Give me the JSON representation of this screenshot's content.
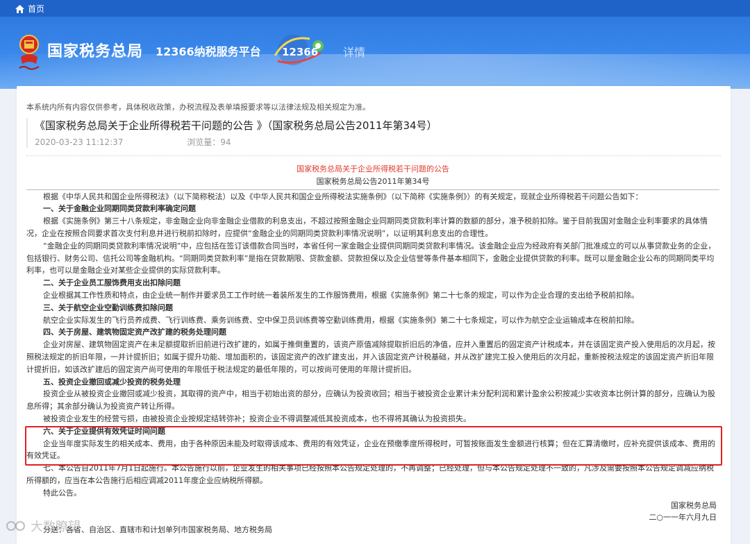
{
  "topbar": {
    "home_label": "首页"
  },
  "header": {
    "bureau_name": "国家税务总局",
    "platform_name": "12366纳税服务平台",
    "logo_text": "12366",
    "details_label": "详情"
  },
  "disclaimer": "本系统内所有内容仅供参考，具体税收政策，办税流程及表单填报要求等以法律法规及相关规定为准。",
  "article": {
    "title": "《国家税务总局关于企业所得税若干问题的公告 》（国家税务总局公告2011年第34号）",
    "date": "2020-03-23 11:12:37",
    "views": "浏览量：94"
  },
  "document": {
    "heading": "国家税务总局关于企业所得税若干问题的公告",
    "subheading": "国家税务总局公告2011年第34号",
    "intro": "根据《中华人民共和国企业所得税法》（以下简称税法）以及《中华人民共和国企业所得税法实施条例》（以下简称《实施条例》）的有关规定，现就企业所得税若干问题公告如下：",
    "s1_title": "一、关于金融企业同期同类贷款利率确定问题",
    "s1_p1": "根据《实施条例》第三十八条规定，非金融企业向非金融企业借款的利息支出，不超过按照金融企业同期同类贷款利率计算的数额的部分，准予税前扣除。鉴于目前我国对金融企业利率要求的具体情况，企业在按照合同要求首次支付利息并进行税前扣除时，应提供“金融企业的同期同类贷款利率情况说明”，以证明其利息支出的合理性。",
    "s1_p2": "“金融企业的同期同类贷款利率情况说明”中，应包括在签订该借款合同当时，本省任何一家金融企业提供同期同类贷款利率情况。该金融企业应为经政府有关部门批准成立的可以从事贷款业务的企业，包括银行、财务公司、信托公司等金融机构。“同期同类贷款利率”是指在贷款期限、贷款金额、贷款担保以及企业信誉等条件基本相同下，金融企业提供贷款的利率。既可以是金融企业公布的同期同类平均利率，也可以是金融企业对某些企业提供的实际贷款利率。",
    "s2_title": "二、关于企业员工服饰费用支出扣除问题",
    "s2_p1": "企业根据其工作性质和特点，由企业统一制作并要求员工工作时统一着装所发生的工作服饰费用，根据《实施条例》第二十七条的规定，可以作为企业合理的支出给予税前扣除。",
    "s3_title": "三、关于航空企业空勤训练费扣除问题",
    "s3_p1": "航空企业实际发生的飞行员养成费、飞行训练费、乘务训练费、空中保卫员训练费等空勤训练费用，根据《实施条例》第二十七条规定，可以作为航空企业运输成本在税前扣除。",
    "s4_title": "四、关于房屋、建筑物固定资产改扩建的税务处理问题",
    "s4_p1": "企业对房屋、建筑物固定资产在未足额提取折旧前进行改扩建的，如属于推倒重置的，该资产原值减除提取折旧后的净值，应并入重置后的固定资产计税成本，并在该固定资产投入使用后的次月起，按照税法规定的折旧年限，一并计提折旧；如属于提升功能、增加面积的，该固定资产的改扩建支出，并入该固定资产计税基础，并从改扩建完工投入使用后的次月起，重新按税法规定的该固定资产折旧年限计提折旧，如该改扩建后的固定资产尚可使用的年限低于税法规定的最低年限的，可以按尚可使用的年限计提折旧。",
    "s5_title": "五、投资企业撤回或减少投资的税务处理",
    "s5_p1": "投资企业从被投资企业撤回或减少投资，其取得的资产中，相当于初始出资的部分，应确认为投资收回；相当于被投资企业累计未分配利润和累计盈余公积按减少实收资本比例计算的部分，应确认为股息所得；其余部分确认为投资资产转让所得。",
    "s5_p2": "被投资企业发生的经营亏损，由被投资企业按规定结转弥补；投资企业不得调整减低其投资成本，也不得将其确认为投资损失。",
    "s6_title": "六、关于企业提供有效凭证时间问题",
    "s6_p1": "企业当年度实际发生的相关成本、费用，由于各种原因未能及时取得该成本、费用的有效凭证，企业在预缴季度所得税时，可暂按账面发生金额进行核算；但在汇算清缴时，应补充提供该成本、费用的有效凭证。",
    "s7_p1": "七、本公告自2011年7月1日起施行。本公告施行以前，企业发生的相关事项已经按照本公告规定处理的，不再调整；已经处理，但与本公告规定处理不一致的，凡涉及需要按照本公告规定调减应纳税所得额的，应当在本公告施行后相应调减2011年度企业应纳税所得额。",
    "closing": "特此公告。",
    "signature": "国家税务总局",
    "sign_date": "二○一一年六月九日",
    "distribution": "分送：各省、自治区、直辖市和计划单列市国家税务局、地方税务局"
  },
  "watermark": "大数瞭望",
  "colors": {
    "topbar": "#1f62c8",
    "banner": "#3b89ec",
    "red": "#e23b2e",
    "highlight": "#e02020"
  }
}
